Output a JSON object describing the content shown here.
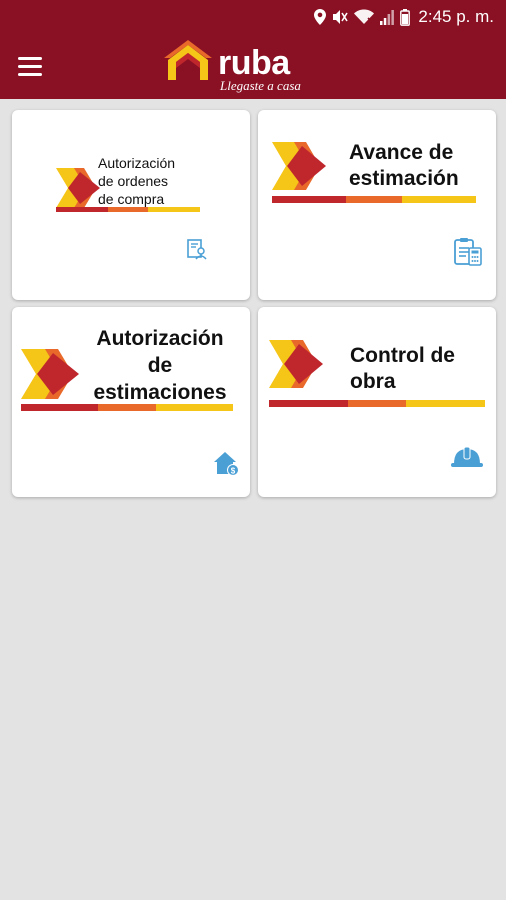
{
  "status_bar": {
    "time": "2:45 p. m.",
    "icons": [
      "location-icon",
      "mute-icon",
      "wifi-icon",
      "signal-icon",
      "battery-icon"
    ]
  },
  "app_bar": {
    "menu_icon": "hamburger-menu-icon",
    "logo_word": "ruba",
    "logo_tagline": "Llegaste a casa"
  },
  "colors": {
    "brand": "#8a1023",
    "background": "#e3e3e3",
    "card": "#ffffff",
    "accent_red": "#c0272d",
    "accent_orange": "#e8692a",
    "accent_yellow": "#f5c518",
    "icon_blue": "#4a9fd5"
  },
  "cards": [
    {
      "title_lines": [
        "Autorización",
        "de ordenes",
        "de compra"
      ],
      "icon": "document-user-icon"
    },
    {
      "title_lines": [
        "Avance de",
        "estimación"
      ],
      "icon": "clipboard-calculator-icon"
    },
    {
      "title_lines": [
        "Autorización",
        "de",
        "estimaciones"
      ],
      "icon": "house-money-icon"
    },
    {
      "title_lines": [
        "Control de",
        "obra"
      ],
      "icon": "hard-hat-icon"
    }
  ]
}
